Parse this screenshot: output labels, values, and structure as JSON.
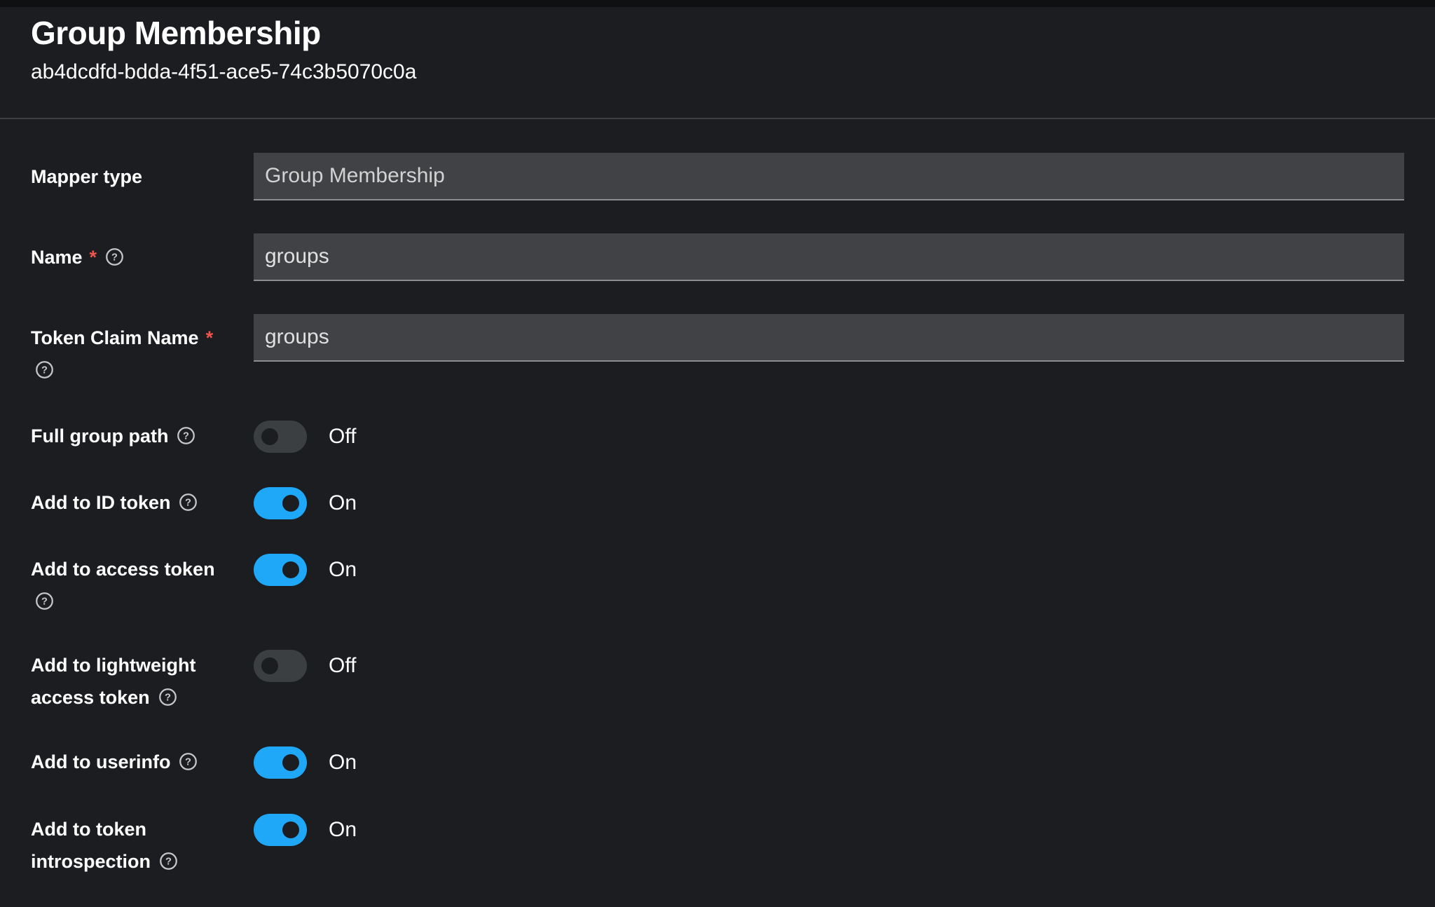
{
  "header": {
    "title": "Group Membership",
    "subtitle": "ab4dcdfd-bdda-4f51-ace5-74c3b5070c0a"
  },
  "form": {
    "mapper_type": {
      "label": "Mapper type",
      "value": "Group Membership"
    },
    "name": {
      "label": "Name",
      "required_marker": "*",
      "value": "groups"
    },
    "token_claim_name": {
      "label": "Token Claim Name",
      "required_marker": "*",
      "value": "groups"
    },
    "full_group_path": {
      "label": "Full group path",
      "state": "Off",
      "checked": false
    },
    "add_to_id_token": {
      "label": "Add to ID token",
      "state": "On",
      "checked": true
    },
    "add_to_access_token": {
      "label": "Add to access token",
      "state": "On",
      "checked": true
    },
    "add_to_lightweight_access_token": {
      "label_line1": "Add to lightweight",
      "label_line2": "access token",
      "state": "Off",
      "checked": false
    },
    "add_to_userinfo": {
      "label": "Add to userinfo",
      "state": "On",
      "checked": true
    },
    "add_to_token_introspection": {
      "label_line1": "Add to token",
      "label_line2": "introspection",
      "state": "On",
      "checked": true
    }
  },
  "colors": {
    "background": "#1b1d21",
    "input_background": "#414245",
    "switch_on": "#1fa7f8",
    "switch_off": "#3c3f42",
    "required": "#f0554b"
  },
  "icons": {
    "help": "help-circle-icon"
  }
}
